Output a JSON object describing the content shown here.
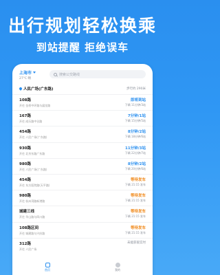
{
  "hero": {
    "title": "出行规划轻松换乘",
    "subtitle": "到站提醒 拒绝误车"
  },
  "topbar": {
    "city": "上海市",
    "weather": "27°C 晴",
    "search_placeholder": "搜索公交路线"
  },
  "station": {
    "name": "人民广场(广东路)",
    "right": "步行约 290米"
  },
  "routes": [
    {
      "name": "108路",
      "dest": "开往 金桥中环路与展览路",
      "status": "即将到站",
      "next": "下辆 11分钟/3站",
      "type": "blue"
    },
    {
      "name": "167路",
      "dest": "开往 成乐路中谷路",
      "status": "7分钟/1站",
      "next": "下辆 15分钟/5站",
      "type": "blue"
    },
    {
      "name": "454路",
      "dest": "开往 人民广场(广东路)",
      "status": "8分钟/2站",
      "next": "下辆 18分钟/6站",
      "type": "blue"
    },
    {
      "name": "930路",
      "dest": "开往 北京东路广东路",
      "status": "11分钟/3站",
      "next": "下辆 22分钟/7站",
      "type": "blue"
    },
    {
      "name": "980路",
      "dest": "开往 人民广场(广东路)",
      "status": "8分钟/2站",
      "next": "下辆 20分钟/6站",
      "type": "blue"
    },
    {
      "name": "454路",
      "dest": "开往 东方医院路(天平路)",
      "status": "等待发车",
      "next": "下辆 21:15 发车",
      "type": "wait"
    },
    {
      "name": "980路",
      "dest": "开往 杭州湾路新港路",
      "status": "等待发车",
      "next": "下辆 21:15 发车",
      "type": "wait"
    },
    {
      "name": "城建三线",
      "dest": "开往 华山路与四川路",
      "status": "等待发车",
      "next": "下辆 21:15 发车",
      "type": "wait"
    },
    {
      "name": "108路区间",
      "dest": "开往 城建路与兴庆路",
      "status": "等待发车",
      "next": "下辆 21:15 发车",
      "type": "wait"
    },
    {
      "name": "312路",
      "dest": "开往 人民广场",
      "status": "未能获取实时",
      "next": "",
      "type": "gray"
    }
  ],
  "tabs": [
    {
      "label": "首页"
    },
    {
      "label": "我的"
    }
  ]
}
